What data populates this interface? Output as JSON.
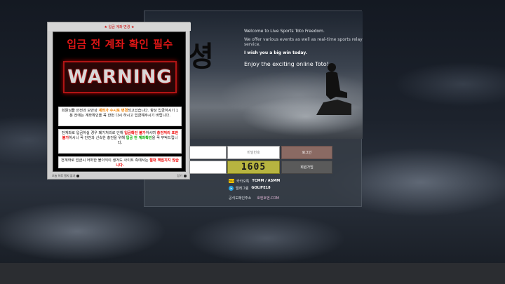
{
  "hero": {
    "brand_char": "셩",
    "welcome": "Welcome to Live Sports Toto Freedom.",
    "offer": "We offer various events as well as real-time sports relay service.",
    "wish": "I wish you a big win today.",
    "enjoy": "Enjoy the exciting online Toto!"
  },
  "login": {
    "password_placeholder": "비밀번호",
    "login_label": "로그인",
    "captcha": "1605",
    "join_label": "회원가입"
  },
  "contact": {
    "kakao_label": "카카오톡",
    "kakao_value": "TCMM / ASMM",
    "telegram_label": "텔레그램",
    "telegram_value": "GOLIFE18",
    "address_label": "공식도메인주소",
    "address_value": "호엔호엔.COM",
    "kakao_icon_text": "TALK"
  },
  "popup": {
    "title": "★ 입금 계좌 변경 ★",
    "headline": "입금 전 계좌 확인 필수",
    "warning": "WARNING",
    "msg1": {
      "a": "회원님들 안전과 보안상 ",
      "b": "계좌가 수시로 변경",
      "c": "되고있습니다. 항상 입금하시기 1분 전에는 계좌확인을 꼭 한번 다시 하시고 입금해주시기 바랍니다."
    },
    "msg2": {
      "a": "전계좌로 입금하실 경우 폐기처리로 인해 ",
      "b": "입금확인 불가",
      "c": "하시며 ",
      "d": "충전처리 또한 불가",
      "e": "하시니 꼭 안전과 신속한 충전을 위해 ",
      "f": "입금 전 계좌확인",
      "g": "을 꼭 부탁드립니다."
    },
    "msg3": {
      "a": "전계좌로 입금시 어떠한 불이익이 생겨도 사이트 측에서는 ",
      "b": "절대 책임지지 않습니다."
    },
    "footer_left": "오늘 하루 열지 않기",
    "footer_right": "닫기"
  }
}
